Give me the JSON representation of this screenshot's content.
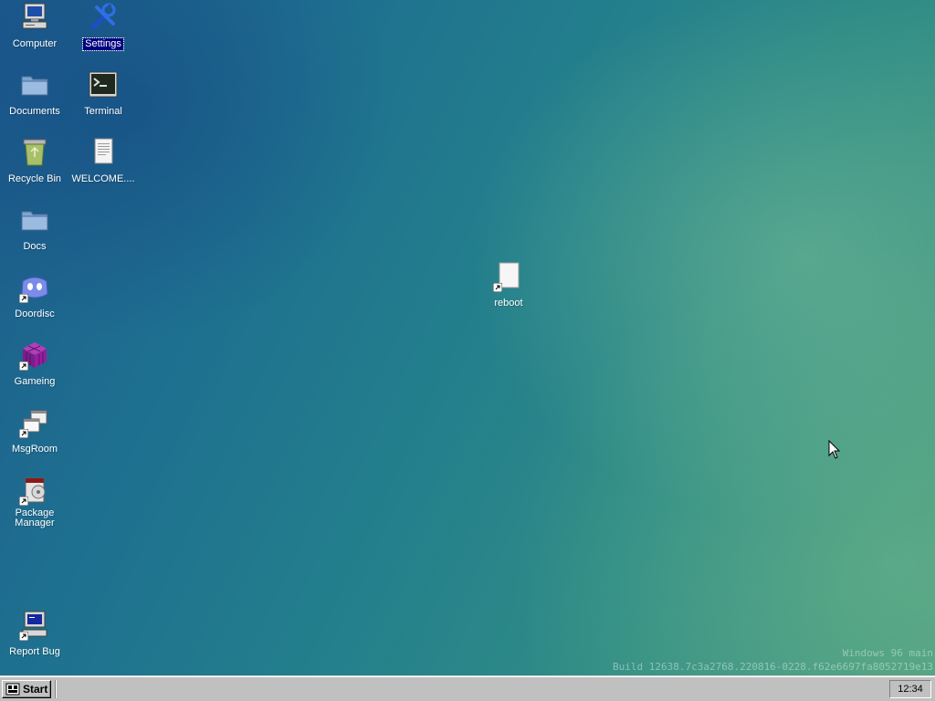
{
  "desktop": {
    "icons": [
      {
        "label": "Computer",
        "icon": "computer-icon",
        "selected": false
      },
      {
        "label": "Settings",
        "icon": "settings-icon",
        "selected": true
      },
      {
        "label": "Documents",
        "icon": "folder-icon",
        "selected": false
      },
      {
        "label": "Terminal",
        "icon": "terminal-icon",
        "selected": false
      },
      {
        "label": "Recycle Bin",
        "icon": "recycle-bin-icon",
        "selected": false
      },
      {
        "label": "WELCOME....",
        "icon": "text-document-icon",
        "selected": false
      },
      {
        "label": "Docs",
        "icon": "folder-icon",
        "selected": false
      },
      {
        "label": "Doordisc",
        "icon": "doordisc-icon",
        "selected": false
      },
      {
        "label": "Gameing",
        "icon": "cube-icon",
        "selected": false
      },
      {
        "label": "MsgRoom",
        "icon": "chat-windows-icon",
        "selected": false
      },
      {
        "label": "Package Manager",
        "icon": "package-manager-icon",
        "selected": false
      },
      {
        "label": "Report Bug",
        "icon": "report-bug-icon",
        "selected": false
      },
      {
        "label": "reboot",
        "icon": "blank-file-icon",
        "selected": false
      }
    ]
  },
  "watermark": {
    "line1": "Windows 96 main",
    "line2": "Build 12638.7c3a2768.220816-0228.f62e6697fa8052719e13"
  },
  "taskbar": {
    "start_label": "Start",
    "clock": "12:34"
  },
  "colors": {
    "selection": "#000080",
    "taskbar": "#c0c0c0"
  }
}
